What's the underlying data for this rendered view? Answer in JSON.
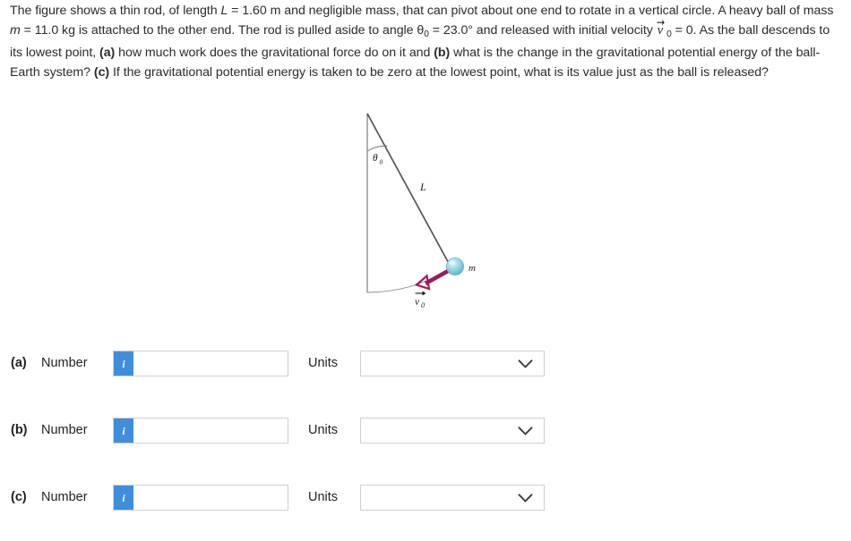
{
  "problem": {
    "part1": "The figure shows a thin rod, of length ",
    "L_sym": "L",
    "L_eq": " = 1.60 m and negligible mass, that can pivot about one end to rotate in a vertical circle. A heavy ball of mass ",
    "m_sym": "m",
    "m_eq": " = 11.0 kg is attached to the other end. The rod is pulled aside to angle ",
    "theta_sym": "θ",
    "theta_sub": "0",
    "theta_eq": " = 23.0° and released with initial velocity ",
    "v_sym": "v",
    "v_sub": "0",
    "v_eq": " = 0. As the ball descends to its lowest point, ",
    "bold_a": "(a)",
    "part_a_text": " how much work does the gravitational force do on it and ",
    "bold_b": "(b)",
    "part_b_text": " what is the change in the gravitational potential energy of the ball-Earth system? ",
    "bold_c": "(c)",
    "part_c_text": " If the gravitational potential energy is taken to be zero at the lowest point, what is its value just as the ball is released?"
  },
  "figure": {
    "label_theta": "θ",
    "label_theta_sub": "0",
    "label_L": "L",
    "label_m": "m",
    "label_v": "v",
    "label_v_sub": "0",
    "colors": {
      "ball_fill": "#9ad5e3",
      "ball_highlight": "#d6eef5",
      "ball_edge": "#5fb4c9",
      "arrow": "#9c1a5c",
      "line": "#555555",
      "arc": "#7a7a7a"
    }
  },
  "answers": {
    "number_label": "Number",
    "units_label": "Units",
    "info_icon_text": "i",
    "rows": [
      {
        "tag": "(a)",
        "value": "",
        "placeholder": "",
        "unit_value": ""
      },
      {
        "tag": "(b)",
        "value": "",
        "placeholder": "",
        "unit_value": ""
      },
      {
        "tag": "(c)",
        "value": "",
        "placeholder": "",
        "unit_value": ""
      }
    ]
  },
  "theme": {
    "info_button_blue": "#3f8edc",
    "border_gray": "#cfcfcf",
    "text_color": "#231f20"
  }
}
